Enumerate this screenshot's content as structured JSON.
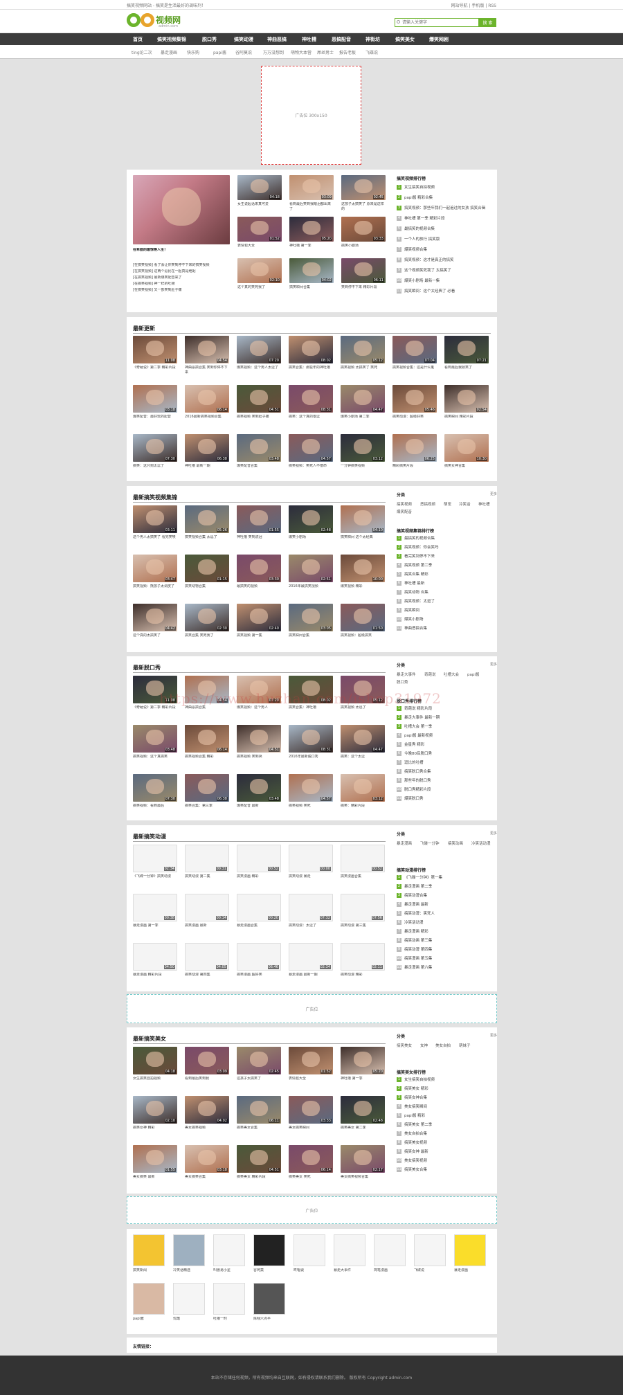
{
  "topbar": {
    "left": "搞笑视频网站 - 搞笑是生活最好的调味剂！",
    "right": "网站导航 | 手机版 | RSS"
  },
  "logo": {
    "text": "视频网",
    "domain": "admin.com"
  },
  "search": {
    "placeholder": "请输入关键字",
    "button": "搜 索"
  },
  "nav": [
    "首页",
    "搞笑视频集锦",
    "脱口秀",
    "搞笑动漫",
    "神曲恶搞",
    "神吐槽",
    "恶搞配音",
    "神街坊",
    "搞笑美女",
    "爆笑网剧"
  ],
  "subnav": [
    "ting论二次",
    "暴走漫画",
    "快乐购",
    "papi酱",
    "谷阿莫说",
    "万万没想到",
    "萌物大本营",
    "屌丝男士",
    "报告老板",
    "飞碟说"
  ],
  "ads": {
    "top": "广告位 300x150",
    "mid": "广告位",
    "bottom": "广告位"
  },
  "featured": {
    "big_title": "在希腊的最惊艳人生！",
    "lines": [
      "[在搞笑视频] 看了会让你笑到停不下来的搞笑视频",
      "[在搞笑视频] 这两个逗比在一起真是绝配",
      "[在搞笑视频] 最新爆笑配音来了",
      "[在搞笑视频] 神一样的吐槽",
      "[在搞笑视频] 又一部笑到肚子痛"
    ],
    "grid": [
      {
        "t": "女生说起话来真可爱",
        "tm": "04:18"
      },
      {
        "t": "看到最后笑到我眼泪都出来了",
        "tm": "03:09"
      },
      {
        "t": "这孩子太搞笑了 原来是这样的",
        "tm": "02:45"
      },
      {
        "t": "表情包大全",
        "tm": "01:52"
      },
      {
        "t": "神吐槽 第一季",
        "tm": "05:20"
      },
      {
        "t": "搞笑小剧场",
        "tm": "03:33"
      },
      {
        "t": "这个真的笑死我了",
        "tm": "02:10"
      },
      {
        "t": "搞笑瞬间合集",
        "tm": "04:02"
      },
      {
        "t": "笑到停不下来 精彩片段",
        "tm": "06:11"
      }
    ],
    "rank_title": "搞笑视频排行榜",
    "rank": [
      "女生搞笑自拍视频",
      "papi酱 精彩合集",
      "搞笑视频：那些年我们一起追过的女孩 搞笑合辑",
      "神吐槽 第一季 精彩片段",
      "最搞笑的视频合集",
      "一个人的旅行 搞笑版",
      "爆笑视频合集",
      "搞笑视频：这才是真正的搞笑",
      "这个视频笑死我了 太搞笑了",
      "爆笑小剧场 最新一集",
      "搞笑瞬间：这个太经典了 必看"
    ]
  },
  "latest": {
    "title": "最新更新",
    "items": [
      {
        "t": "《奇葩说》第二季 精彩片段",
        "tm": "11:08"
      },
      {
        "t": "神曲恶搞合集 笑到你停不下来",
        "tm": "04:54"
      },
      {
        "t": "爆笑视频：这个男人太逗了",
        "tm": "07:20"
      },
      {
        "t": "搞笑合集：那些年的神吐槽",
        "tm": "08:02"
      },
      {
        "t": "搞笑视频 太搞笑了 笑死",
        "tm": "05:12"
      },
      {
        "t": "搞笑视频合集：这是什么鬼",
        "tm": "07:04"
      },
      {
        "t": "看到最后我就笑了",
        "tm": "07:21"
      },
      {
        "t": "爆笑配音：最好玩的配音",
        "tm": "03:18"
      },
      {
        "t": "2016最新搞笑视频合集",
        "tm": "06:14"
      },
      {
        "t": "搞笑视频 笑到肚子痛",
        "tm": "04:51"
      },
      {
        "t": "搞笑：这个真的很逗",
        "tm": "08:31"
      },
      {
        "t": "爆笑小剧场 第二季",
        "tm": "04:47"
      },
      {
        "t": "搞笑动漫：超级好笑",
        "tm": "05:46"
      },
      {
        "t": "搞笑瞬间 精彩片段",
        "tm": "02:54"
      },
      {
        "t": "搞笑：这只狗太逗了",
        "tm": "07:30"
      },
      {
        "t": "神吐槽 最新一期",
        "tm": "06:38"
      },
      {
        "t": "爆笑配音合集",
        "tm": "03:48"
      },
      {
        "t": "搞笑视频：笑死人不偿命",
        "tm": "04:57"
      },
      {
        "t": "一分钟搞笑视频",
        "tm": "03:12"
      },
      {
        "t": "精彩搞笑片段",
        "tm": "06:25"
      },
      {
        "t": "搞笑女神合集",
        "tm": "10:30"
      }
    ]
  },
  "funny": {
    "title": "最新搞笑视频集锦",
    "items": [
      {
        "t": "这个男人太搞笑了 看完笑喷",
        "tm": "03:11"
      },
      {
        "t": "搞笑视频合集 太逗了",
        "tm": "05:26"
      },
      {
        "t": "神吐槽 笑到流泪",
        "tm": "01:55"
      },
      {
        "t": "爆笑小剧场",
        "tm": "02:48"
      },
      {
        "t": "搞笑瞬间 这个太经典",
        "tm": "04:10"
      },
      {
        "t": "搞笑视频：熊孩子太调皮了",
        "tm": "03:47"
      },
      {
        "t": "搞笑动物合集",
        "tm": "01:15"
      },
      {
        "t": "最搞笑的视频",
        "tm": "03:30"
      },
      {
        "t": "2016年最搞笑视频",
        "tm": "02:51"
      },
      {
        "t": "爆笑视频 精彩",
        "tm": "10:00"
      },
      {
        "t": "这个真的太搞笑了",
        "tm": "04:42"
      },
      {
        "t": "搞笑合集 笑死我了",
        "tm": "02:30"
      },
      {
        "t": "搞笑视频 第一集",
        "tm": "02:40"
      },
      {
        "t": "搞笑瞬间合集",
        "tm": "03:05"
      },
      {
        "t": "搞笑视频：超级搞笑",
        "tm": "01:50"
      }
    ],
    "side_h": "分类",
    "side_m": "更多",
    "tags": [
      "搞笑视频",
      "恶搞视频",
      "萌宠",
      "冷笑话",
      "神吐槽",
      "爆笑配音"
    ],
    "rank_title": "搞笑视频集锦排行榜",
    "rank": [
      "最搞笑的视频合集",
      "搞笑视频：你会笑吗",
      "看完笑到停不下来",
      "搞笑视频 第二季",
      "搞笑合集 精彩",
      "神吐槽 最新",
      "搞笑动物 合集",
      "搞笑视频：太逗了",
      "搞笑瞬间",
      "爆笑小剧场",
      "神曲恶搞合集"
    ]
  },
  "talk": {
    "title": "最新脱口秀",
    "items": [
      {
        "t": "《奇葩说》第二季 精彩片段",
        "tm": "11:08"
      },
      {
        "t": "神曲恶搞合集",
        "tm": "04:54"
      },
      {
        "t": "爆笑视频：这个男人",
        "tm": "07:20"
      },
      {
        "t": "搞笑合集：神吐槽",
        "tm": "08:02"
      },
      {
        "t": "搞笑视频 太逗了",
        "tm": "05:12"
      },
      {
        "t": "搞笑视频：这个真搞笑",
        "tm": "03:48"
      },
      {
        "t": "搞笑视频合集 精彩",
        "tm": "06:14"
      },
      {
        "t": "搞笑视频 笑到哭",
        "tm": "04:51"
      },
      {
        "t": "2016年最新脱口秀",
        "tm": "08:31"
      },
      {
        "t": "搞笑：这个太逗",
        "tm": "04:47"
      },
      {
        "t": "搞笑视频：看到最后",
        "tm": "07:30"
      },
      {
        "t": "搞笑合集：第三季",
        "tm": "06:38"
      },
      {
        "t": "爆笑配音 最新",
        "tm": "03:48"
      },
      {
        "t": "搞笑视频 笑死",
        "tm": "04:57"
      },
      {
        "t": "搞笑：精彩片段",
        "tm": "03:12"
      }
    ],
    "side_h": "分类",
    "side_m": "更多",
    "tags": [
      "暴走大事件",
      "奇葩说",
      "吐槽大会",
      "papi酱",
      "脱口秀"
    ],
    "rank_title": "脱口秀排行榜",
    "rank": [
      "奇葩说 精彩片段",
      "暴走大事件 最新一期",
      "吐槽大会 第一季",
      "papi酱 最新视频",
      "金星秀 精彩",
      "今晚80后脱口秀",
      "逗比的吐槽",
      "搞笑脱口秀合集",
      "那些年的脱口秀",
      "脱口秀精彩片段",
      "爆笑脱口秀"
    ]
  },
  "anime": {
    "title": "最新搞笑动漫",
    "items": [
      {
        "t": "《飞碟一分钟》搞笑动漫",
        "tm": "02:34"
      },
      {
        "t": "搞笑动漫 第二集",
        "tm": "00:31"
      },
      {
        "t": "搞笑漫画 精彩",
        "tm": "00:52"
      },
      {
        "t": "搞笑动漫 暴走",
        "tm": "00:00"
      },
      {
        "t": "搞笑漫画合集",
        "tm": "00:52"
      },
      {
        "t": "暴走漫画 第一季",
        "tm": "00:38"
      },
      {
        "t": "搞笑漫画 最新",
        "tm": "00:14"
      },
      {
        "t": "暴走漫画合集",
        "tm": "00:20"
      },
      {
        "t": "搞笑动漫：太逗了",
        "tm": "07:32"
      },
      {
        "t": "搞笑动漫 第三集",
        "tm": "07:56"
      },
      {
        "t": "暴走漫画 精彩片段",
        "tm": "04:50"
      },
      {
        "t": "搞笑动漫 第四集",
        "tm": "04:05"
      },
      {
        "t": "搞笑漫画 超好笑",
        "tm": "06:46"
      },
      {
        "t": "暴走漫画 最新一期",
        "tm": "02:34"
      },
      {
        "t": "搞笑动漫 精彩",
        "tm": "02:11"
      }
    ],
    "side_h": "分类",
    "side_m": "更多",
    "tags": [
      "暴走漫画",
      "飞碟一分钟",
      "搞笑动画",
      "冷笑话动漫"
    ],
    "rank_title": "搞笑动漫排行榜",
    "rank": [
      "《飞碟一分钟》第一集",
      "暴走漫画 第二季",
      "搞笑动漫合集",
      "暴走漫画 最新",
      "搞笑动漫：笑死人",
      "冷笑话动漫",
      "暴走漫画 精彩",
      "搞笑动画 第三集",
      "搞笑动漫 第四集",
      "搞笑漫画 第五集",
      "暴走漫画 第六集"
    ]
  },
  "beauty": {
    "title": "最新搞笑美女",
    "items": [
      {
        "t": "女生搞笑自拍视频",
        "tm": "04:18"
      },
      {
        "t": "看到最后笑到我",
        "tm": "03:09"
      },
      {
        "t": "这孩子太搞笑了",
        "tm": "02:45"
      },
      {
        "t": "表情包大全",
        "tm": "01:52"
      },
      {
        "t": "神吐槽 第一季",
        "tm": "05:20"
      },
      {
        "t": "搞笑女神 精彩",
        "tm": "02:10"
      },
      {
        "t": "美女搞笑视频",
        "tm": "04:02"
      },
      {
        "t": "搞笑美女合集",
        "tm": "06:11"
      },
      {
        "t": "美女搞笑瞬间",
        "tm": "03:33"
      },
      {
        "t": "搞笑美女 第二季",
        "tm": "02:48"
      },
      {
        "t": "美女搞笑 最新",
        "tm": "01:55"
      },
      {
        "t": "美女搞笑合集",
        "tm": "03:18"
      },
      {
        "t": "搞笑美女 精彩片段",
        "tm": "04:51"
      },
      {
        "t": "搞笑美女 笑死",
        "tm": "06:14"
      },
      {
        "t": "美女搞笑视频合集",
        "tm": "02:17"
      }
    ],
    "side_h": "分类",
    "side_m": "更多",
    "tags": [
      "搞笑美女",
      "女神",
      "美女自拍",
      "萌妹子"
    ],
    "rank_title": "搞笑美女排行榜",
    "rank": [
      "女生搞笑自拍视频",
      "搞笑美女 精彩",
      "搞笑女神合集",
      "美女搞笑瞬间",
      "papi酱 精彩",
      "搞笑美女 第二季",
      "美女自拍合集",
      "搞笑美女视频",
      "搞笑女神 最新",
      "美女搞笑视频",
      "搞笑美女合集"
    ]
  },
  "brands": [
    {
      "name": "搞笑新闻",
      "label": "搞笑新闻",
      "bg": "#f3c431"
    },
    {
      "name": "冷笑话",
      "label": "冷笑话精选",
      "bg": "#9eb0c0"
    },
    {
      "name": "叫兽易小星",
      "label": "叫兽易小星",
      "bg": "#f5f5f5"
    },
    {
      "name": "谷阿莫",
      "label": "谷阿莫",
      "bg": "#222222"
    },
    {
      "name": "咚唱谈",
      "label": "咚唱谈",
      "bg": "#f5f5f5"
    },
    {
      "name": "暴走大事件",
      "label": "暴走大事件",
      "bg": "#f5f5f5"
    },
    {
      "name": "简笔漫画",
      "label": "简笔漫画",
      "bg": "#f5f5f5"
    },
    {
      "name": "飞碟说",
      "label": "飞碟说",
      "bg": "#f5f5f5"
    },
    {
      "name": "暴走漫画",
      "label": "暴走漫画",
      "bg": "#fadd2a"
    },
    {
      "name": "papi酱",
      "label": "papi酱",
      "bg": "#d9b9a4"
    },
    {
      "name": "优酷",
      "label": "优酷",
      "bg": "#f5f5f5"
    },
    {
      "name": "吐槽一时",
      "label": "吐槽一时",
      "bg": "#f5f5f5"
    },
    {
      "name": "陈翔六点半",
      "label": "陈翔六点半",
      "bg": "#555555"
    }
  ],
  "links_title": "友情链接：",
  "footer": "本站不存储任何视频，所有视频均来自互联网，如有侵权请联系我们删除。 版权所有 Copyright admin.com",
  "watermark": "https://www.huzhan.com/ishop31972",
  "colors": {
    "accent": "#6cb42c",
    "nav": "#3c3c3c"
  }
}
